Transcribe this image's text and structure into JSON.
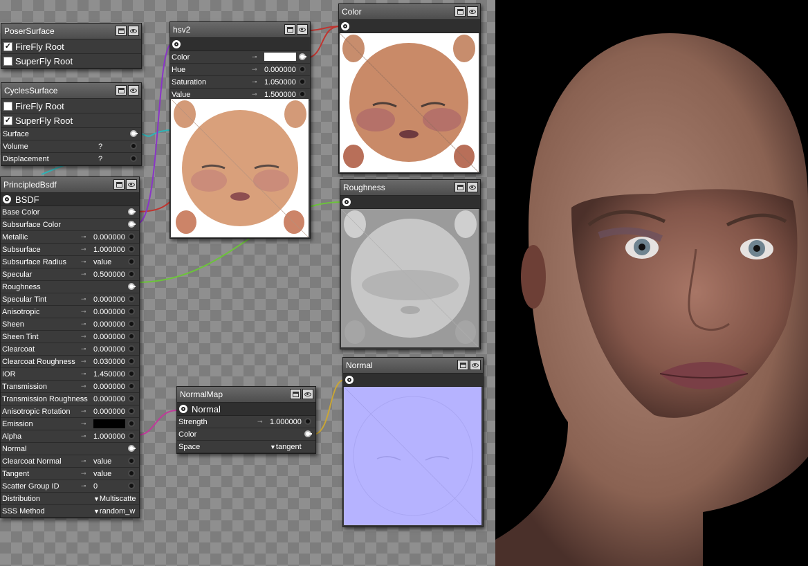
{
  "colors": {
    "wire_red": "#c0332e",
    "wire_purple": "#8a35c8",
    "wire_cyan": "#2eb5b8",
    "wire_green": "#6cc43a",
    "wire_magenta": "#c0399a",
    "wire_yellow": "#c9a636",
    "canvas": "#8f8f8f",
    "node": "#3a3a3a",
    "normal_map": "#b6b3ff"
  },
  "poser_surface": {
    "title": "PoserSurface",
    "rows": [
      {
        "label": "FireFly Root",
        "checked": true
      },
      {
        "label": "SuperFly Root",
        "checked": false
      }
    ]
  },
  "cycles_surface": {
    "title": "CyclesSurface",
    "rows": [
      {
        "label": "FireFly Root",
        "checked": false
      },
      {
        "label": "SuperFly Root",
        "checked": true
      }
    ],
    "inputs": [
      {
        "label": "Surface",
        "value": ""
      },
      {
        "label": "Volume",
        "value": "?"
      },
      {
        "label": "Displacement",
        "value": "?"
      }
    ]
  },
  "principled": {
    "title": "PrincipledBsdf",
    "output": "BSDF",
    "inputs": [
      {
        "label": "Base Color",
        "value": "",
        "kind": "link"
      },
      {
        "label": "Subsurface Color",
        "value": "",
        "kind": "link"
      },
      {
        "label": "Metallic",
        "value": "0.000000",
        "kind": "num"
      },
      {
        "label": "Subsurface",
        "value": "1.000000",
        "kind": "num"
      },
      {
        "label": "Subsurface Radius",
        "value": "value",
        "kind": "num"
      },
      {
        "label": "Specular",
        "value": "0.500000",
        "kind": "num"
      },
      {
        "label": "Roughness",
        "value": "",
        "kind": "link"
      },
      {
        "label": "Specular Tint",
        "value": "0.000000",
        "kind": "num"
      },
      {
        "label": "Anisotropic",
        "value": "0.000000",
        "kind": "num"
      },
      {
        "label": "Sheen",
        "value": "0.000000",
        "kind": "num"
      },
      {
        "label": "Sheen Tint",
        "value": "0.000000",
        "kind": "num"
      },
      {
        "label": "Clearcoat",
        "value": "0.000000",
        "kind": "num"
      },
      {
        "label": "Clearcoat Roughness",
        "value": "0.030000",
        "kind": "num"
      },
      {
        "label": "IOR",
        "value": "1.450000",
        "kind": "num"
      },
      {
        "label": "Transmission",
        "value": "0.000000",
        "kind": "num"
      },
      {
        "label": "Transmission Roughness",
        "value": "0.000000",
        "kind": "num"
      },
      {
        "label": "Anisotropic Rotation",
        "value": "0.000000",
        "kind": "num"
      },
      {
        "label": "Emission",
        "value": "",
        "kind": "swatch"
      },
      {
        "label": "Alpha",
        "value": "1.000000",
        "kind": "num"
      },
      {
        "label": "Normal",
        "value": "",
        "kind": "link"
      },
      {
        "label": "Clearcoat Normal",
        "value": "value",
        "kind": "num"
      },
      {
        "label": "Tangent",
        "value": "value",
        "kind": "num"
      },
      {
        "label": "Scatter Group ID",
        "value": "0",
        "kind": "num"
      },
      {
        "label": "Distribution",
        "value": "Multiscatte",
        "kind": "drop"
      },
      {
        "label": "SSS Method",
        "value": "random_w",
        "kind": "drop"
      }
    ]
  },
  "hsv": {
    "title": "hsv2",
    "inputs": [
      {
        "label": "Color",
        "value": "",
        "kind": "swatch"
      },
      {
        "label": "Hue",
        "value": "0.000000",
        "kind": "num"
      },
      {
        "label": "Saturation",
        "value": "1.050000",
        "kind": "num"
      },
      {
        "label": "Value",
        "value": "1.500000",
        "kind": "num"
      }
    ]
  },
  "color_node": {
    "title": "Color"
  },
  "roughness_node": {
    "title": "Roughness"
  },
  "normal_node": {
    "title": "Normal"
  },
  "normalmap": {
    "title": "NormalMap",
    "output": "Normal",
    "inputs": [
      {
        "label": "Strength",
        "value": "1.000000",
        "kind": "num"
      },
      {
        "label": "Color",
        "value": "",
        "kind": "link"
      },
      {
        "label": "Space",
        "value": "tangent",
        "kind": "drop"
      }
    ]
  }
}
